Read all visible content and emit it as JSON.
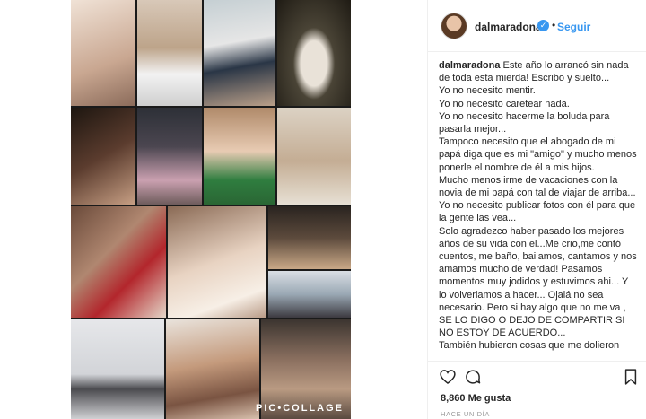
{
  "header": {
    "username": "dalmaradona",
    "verified_icon": "verified-badge-icon",
    "separator": "•",
    "follow_label": "Seguir"
  },
  "collage": {
    "watermark": "PIC•COLLAGE",
    "tile_colors": [
      "#e8d3c4",
      "#c8a98c",
      "#a9b4b8",
      "#3a3a2e",
      "#2d2019",
      "#6b5a5a",
      "#9c7a5a",
      "#d7c8b4",
      "#7a6458",
      "#c9b59e",
      "#31303a",
      "#d9d9df",
      "#8a8a86",
      "#a87c62",
      "#5e5854"
    ]
  },
  "caption": {
    "username": "dalmaradona",
    "lines": [
      "Este año lo arrancó sin nada de toda esta mierda! Escribo y suelto...",
      "Yo no necesito mentir.",
      "Yo no necesito caretear nada.",
      "Yo no necesito hacerme la boluda para pasarla mejor...",
      "Tampoco necesito que el abogado de mi papá diga que es mi \"amigo\" y mucho menos ponerle el nombre de él a mis hijos.",
      "Mucho menos irme de vacaciones con la novia de mi papá con tal de viajar de arriba...",
      "Yo no necesito publicar fotos con él para que la gente las vea...",
      "Solo agradezco haber pasado los mejores años de su vida con el...Me crio,me contó cuentos, me baño, bailamos, cantamos y nos amamos mucho de verdad! Pasamos momentos muy jodidos y estuvimos ahi... Y lo volveriamos a hacer... Ojalá no sea necesario. Pero si hay algo que no me va , SE LO DIGO O DEJO DE COMPARTIR SI NO ESTOY DE ACUERDO...",
      "También hubieron cosas que me dolieron"
    ]
  },
  "actions": {
    "like_icon": "heart-icon",
    "comment_icon": "comment-icon",
    "save_icon": "bookmark-icon"
  },
  "likes": "8,860 Me gusta",
  "timestamp": "HACE UN DÍA"
}
